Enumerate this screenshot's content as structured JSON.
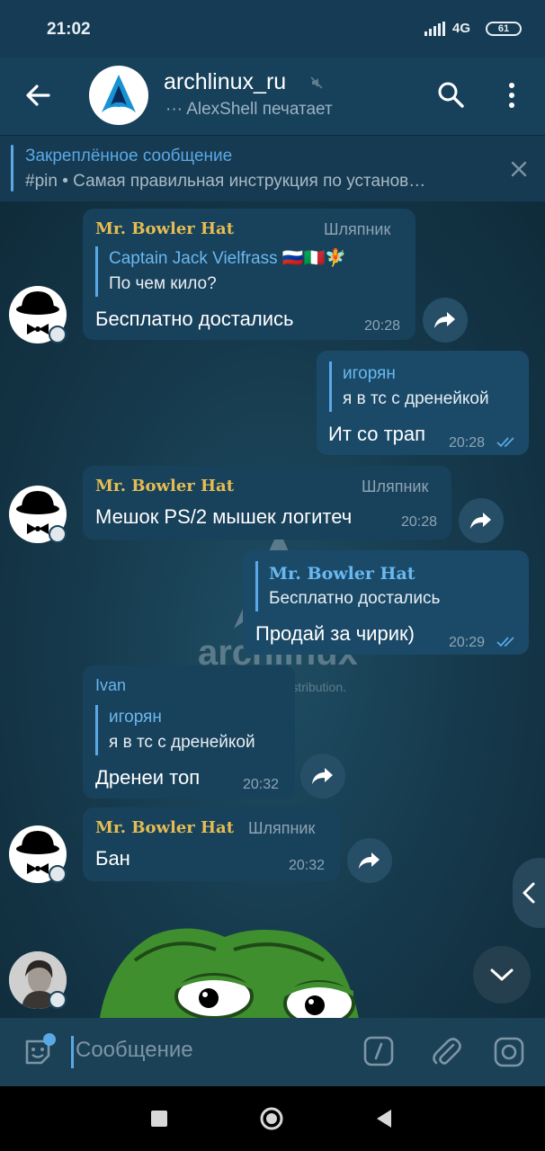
{
  "status_bar": {
    "time": "21:02",
    "network": "4G",
    "battery": "61"
  },
  "header": {
    "title": "archlinux_ru",
    "status": "··· AlexShell печатает",
    "icons": [
      "back-arrow-icon",
      "mute-icon",
      "search-icon",
      "more-vert-icon"
    ]
  },
  "pinned": {
    "title": "Закреплённое сообщение",
    "text": "#pin • Самая правильная инструкция по установ…"
  },
  "messages": [
    {
      "sender": "Mr. Bowler Hat",
      "role": "Шляпник",
      "reply_name": "Captain Jack Vielfrass 🇷🇺🇮🇹🧚",
      "reply_text": "По чем кило?",
      "text": "Бесплатно достались",
      "time": "20:28"
    },
    {
      "reply_name": "игорян",
      "reply_text": "я в тс с дренейкой",
      "text": "Ит со трап",
      "time": "20:28"
    },
    {
      "sender": "Mr. Bowler Hat",
      "role": "Шляпник",
      "text": "Мешок PS/2 мышек логитеч",
      "time": "20:28"
    },
    {
      "reply_name": "Mr. Bowler Hat",
      "reply_text": "Бесплатно достались",
      "text": "Продай за чирик)",
      "time": "20:29"
    },
    {
      "sender": "Ivan",
      "reply_name": "игорян",
      "reply_text": "я в тс с дренейкой",
      "text": "Дренеи топ",
      "time": "20:32"
    },
    {
      "sender": "Mr. Bowler Hat",
      "role": "Шляпник",
      "text": "Бан",
      "time": "20:32"
    }
  ],
  "input": {
    "placeholder": "Сообщение"
  },
  "colors": {
    "accent": "#5aa9e6",
    "sender_gold": "#e5bd52",
    "bubble_in": "#18415b",
    "bubble_out": "#1a4a68"
  }
}
